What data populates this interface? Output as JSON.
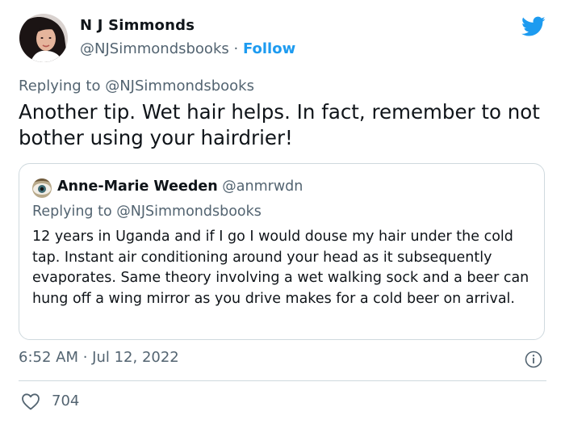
{
  "author": {
    "name": "N J Simmonds",
    "handle": "@NJSimmondsbooks",
    "separator": "·",
    "follow_label": "Follow"
  },
  "reply_context": {
    "prefix": "Replying to",
    "handle": "@NJSimmondsbooks"
  },
  "tweet_text": "Another tip. Wet hair helps. In fact, remember to not bother using your hairdrier!",
  "quoted_tweet": {
    "name": "Anne-Marie Weeden",
    "handle": "@anmrwdn",
    "reply_prefix": "Replying to",
    "reply_handle": "@NJSimmondsbooks",
    "text": "12 years in Uganda and if I go I would douse my hair under the cold tap. Instant air conditioning around your head as it subsequently evaporates. Same theory involving a wet walking sock and a beer can hung off a wing mirror as you drive makes for a cold beer on arrival."
  },
  "timestamp": "6:52 AM · Jul 12, 2022",
  "likes": "704",
  "icons": {
    "brand": "twitter-bird-icon",
    "info": "info-icon",
    "like": "heart-icon"
  },
  "colors": {
    "accent": "#1d9bf0",
    "secondary_text": "#536471",
    "primary_text": "#0f1419",
    "border": "#cfd9de"
  }
}
